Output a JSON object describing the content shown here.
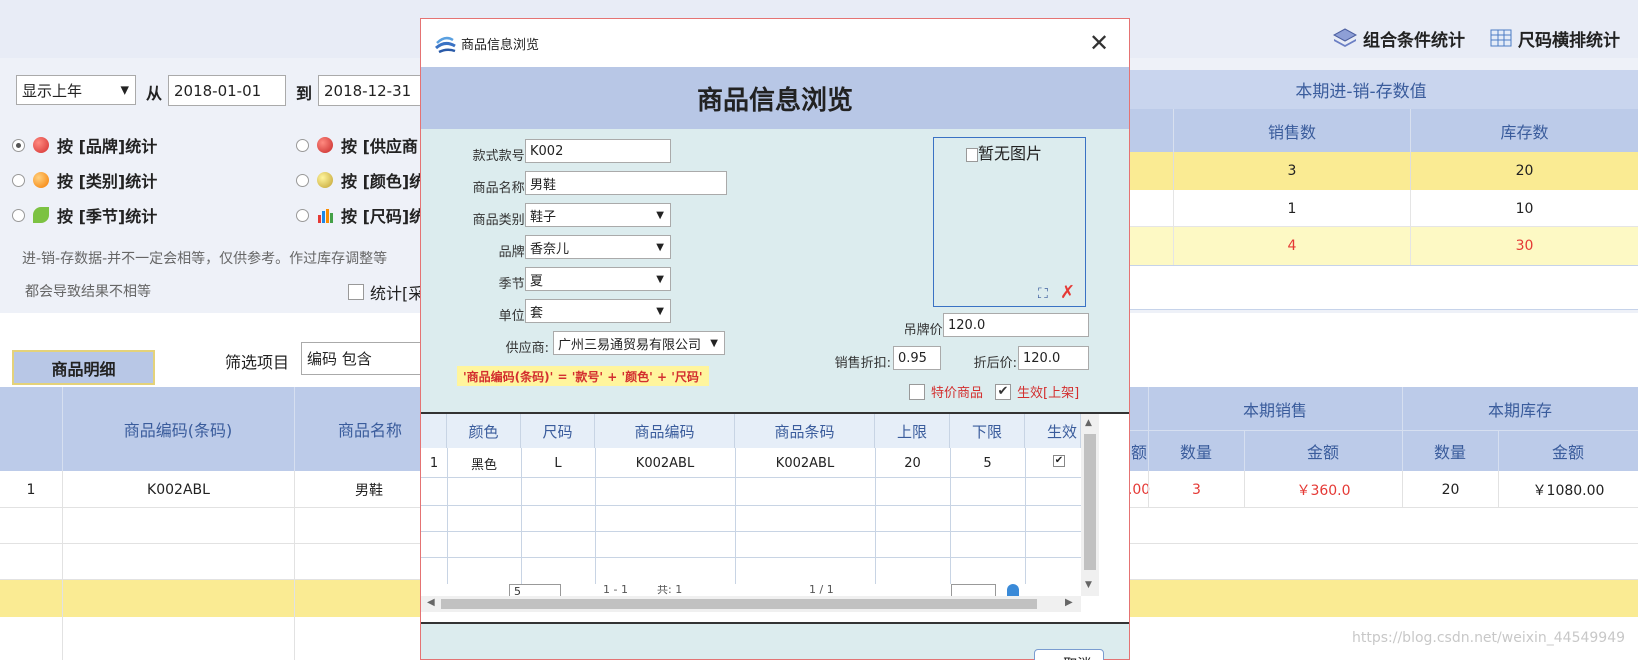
{
  "toolbar": {
    "combo_stat": "组合条件统计",
    "size_stat": "尺码横排统计"
  },
  "filter": {
    "period": "显示上年",
    "from_label": "从",
    "from_date": "2018-01-01",
    "to_label": "到",
    "to_date": "2018-12-31"
  },
  "radios": [
    {
      "label": "按 [品牌]统计",
      "selected": true
    },
    {
      "label": "按 [类别]统计",
      "selected": false
    },
    {
      "label": "按 [季节]统计",
      "selected": false
    },
    {
      "label": "按 [供应商",
      "selected": false
    },
    {
      "label": "按 [颜色]统",
      "selected": false
    },
    {
      "label": "按 [尺码]统",
      "selected": false
    }
  ],
  "notes": {
    "line1": "进-销-存数据-并不一定会相等，仅供参考。作过库存调整等",
    "line2": "都会导致结果不相等",
    "stat_checkbox": "统计[采"
  },
  "summary": {
    "title": "本期进-销-存数值",
    "headers": [
      "销售数",
      "库存数"
    ],
    "rows": [
      {
        "sales": "3",
        "stock": "20"
      },
      {
        "sales": "1",
        "stock": "10"
      },
      {
        "sales": "4",
        "stock": "30"
      }
    ]
  },
  "detail": {
    "tab": "商品明细",
    "filter_label": "筛选项目",
    "filter_value": "编码 包含",
    "headers": {
      "code": "商品编码(条码)",
      "name": "商品名称",
      "partial_amount": "额",
      "period_sales": "本期销售",
      "period_stock": "本期库存",
      "qty": "数量",
      "amount": "金额",
      "qty2": "数量",
      "amount2": "金额"
    },
    "row1": {
      "index": "1",
      "code": "K002ABL",
      "name": "男鞋",
      "partial": ".00",
      "sales_qty": "3",
      "sales_amount": "￥360.0",
      "stock_qty": "20",
      "stock_amount": "￥1080.00"
    }
  },
  "watermark": "https://blog.csdn.net/weixin_44549949",
  "modal": {
    "window_title": "商品信息浏览",
    "header": "商品信息浏览",
    "fields": {
      "style_label": "款式款号:",
      "style_value": "K002",
      "name_label": "商品名称:",
      "name_value": "男鞋",
      "category_label": "商品类别:",
      "category_value": "鞋子",
      "brand_label": "品牌:",
      "brand_value": "香奈儿",
      "season_label": "季节:",
      "season_value": "夏",
      "unit_label": "单位:",
      "unit_value": "套",
      "supplier_label": "供应商:",
      "supplier_value": "广州三易通贸易有限公司",
      "tag_price_label": "吊牌价:",
      "tag_price_value": "120.0",
      "discount_label": "销售折扣:",
      "discount_value": "0.95",
      "after_label": "折后价:",
      "after_value": "120.0"
    },
    "image_alt": "暂无图片",
    "formula": "'商品编码(条码)' = '款号' + '颜色' + '尺码'",
    "special_label": "特价商品",
    "effective_label": "生效[上架]",
    "grid": {
      "headers": [
        "颜色",
        "尺码",
        "商品编码",
        "商品条码",
        "上限",
        "下限",
        "生效"
      ],
      "row": {
        "index": "1",
        "color": "黑色",
        "size": "L",
        "code": "K002ABL",
        "barcode": "K002ABL",
        "upper": "20",
        "lower": "5"
      },
      "pager": {
        "page_size": "5",
        "range": "1 - 1",
        "total": "共: 1",
        "page": "1 / 1"
      }
    },
    "cancel": "取消"
  }
}
